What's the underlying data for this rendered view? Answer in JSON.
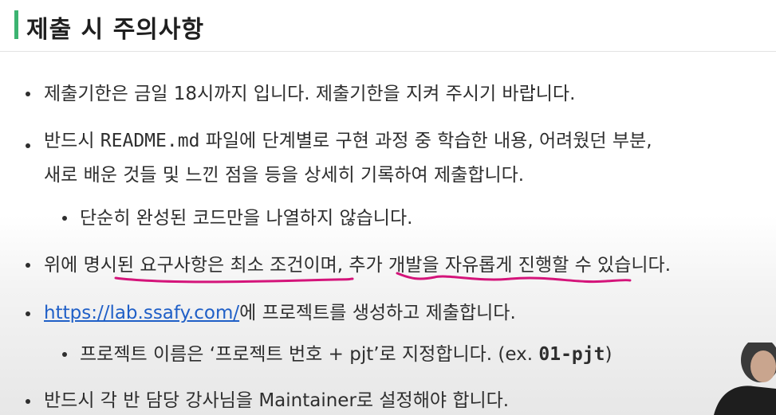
{
  "header": {
    "title": "제출 시 주의사항",
    "accent_color": "#3cb371"
  },
  "items": {
    "item1": "제출기한은 금일 18시까지 입니다. 제출기한을 지켜 주시기 바랍니다.",
    "item2": {
      "prefix": "반드시 ",
      "code": "README.md",
      "suffix": " 파일에 단계별로 구현 과정 중 학습한 내용, 어려웠던 부분,",
      "line2": "새로 배운 것들 및 느낀 점을 등을 상세히 기록하여 제출합니다."
    },
    "item2_sub": "단순히 완성된 코드만을 나열하지 않습니다.",
    "item3": "위에 명시된 요구사항은 최소 조건이며, 추가 개발을 자유롭게 진행할 수 있습니다.",
    "item4": {
      "link": "https://lab.ssafy.com/",
      "suffix": "에 프로젝트를 생성하고 제출합니다."
    },
    "item4_sub": {
      "prefix": "프로젝트 이름은 ‘프로젝트 번호 + pjt’로 지정합니다. (ex. ",
      "code": "01-pjt",
      "suffix": ")"
    },
    "item5": "반드시 각 반 담당 강사님을 Maintainer로 설정해야 합니다."
  },
  "annotation": {
    "color": "#d4147a"
  }
}
